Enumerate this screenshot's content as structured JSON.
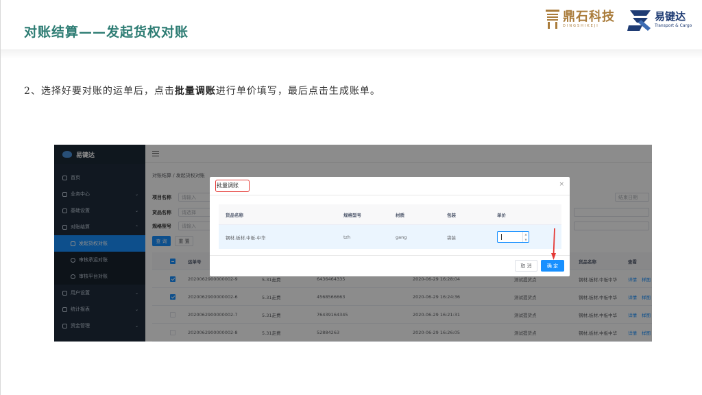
{
  "slide": {
    "title": "对账结算——发起货权对账",
    "instruction_prefix": "2、选择好要对账的运单后，点击",
    "instruction_bold": "批量调账",
    "instruction_suffix": "进行单价填写，最后点击生成账单。"
  },
  "logos": {
    "dingshi_cn": "鼎石科技",
    "dingshi_en": "DINGSHIKEJI",
    "yijianda_cn": "易键达",
    "yijianda_en": "Transport & Cargo"
  },
  "colors": {
    "title": "#2d7c73",
    "primary": "#1890ff",
    "sidebar": "#1f2d3d",
    "highlight_red": "#e53935"
  },
  "app": {
    "brand": "易键达",
    "sidebar": [
      {
        "label": "首页",
        "icon": "home-icon"
      },
      {
        "label": "业务中心",
        "icon": "briefcase-icon",
        "caret": "⌄"
      },
      {
        "label": "基础设置",
        "icon": "gear-icon",
        "caret": "⌄"
      },
      {
        "label": "对账结算",
        "icon": "ledger-icon",
        "caret": "⌃"
      },
      {
        "label": "发起货权对账",
        "icon": "doc-icon",
        "active": true
      },
      {
        "label": "审核承运对账",
        "icon": "check-circle-icon"
      },
      {
        "label": "审核平台对账",
        "icon": "check-circle-icon"
      },
      {
        "label": "用户设置",
        "icon": "user-icon",
        "caret": "⌄"
      },
      {
        "label": "统计报表",
        "icon": "chart-icon",
        "caret": "⌄"
      },
      {
        "label": "资金管理",
        "icon": "wallet-icon",
        "caret": "⌄"
      }
    ],
    "breadcrumb": "对账结算 / 发起货权对账",
    "filters": {
      "project_label": "项目名称",
      "project_placeholder": "请输入",
      "goods_label": "货品名称",
      "goods_placeholder": "请选择",
      "spec_label": "规格型号",
      "spec_placeholder": "请输入",
      "end_date_placeholder": "结束日期"
    },
    "buttons": {
      "query": "查 询",
      "reset": "重 置"
    },
    "table": {
      "headers": [
        "运单号",
        "货品名称",
        "查看"
      ],
      "rows": [
        {
          "checked": true,
          "waybill": "2020062900000002-9",
          "c2": "5.31走费",
          "c3": "6436464335",
          "time": "2020-06-29 16:28:04",
          "shipper": "测试提货点",
          "goods": "钢材,板材,中板中华",
          "view": "详情",
          "view2": "样图"
        },
        {
          "checked": true,
          "waybill": "2020062900000002-6",
          "c2": "5.31走费",
          "c3": "4568566663",
          "time": "2020-06-29 16:24:36",
          "shipper": "测试提货点",
          "goods": "钢材,板材,中板中华",
          "view": "详情",
          "view2": "样图"
        },
        {
          "checked": false,
          "waybill": "2020062900000002-7",
          "c2": "5.31走费",
          "c3": "76439164345",
          "time": "2020-06-29 16:21:31",
          "shipper": "测试提货点",
          "goods": "钢材,板材,中板中华",
          "view": "详情",
          "view2": "样图"
        },
        {
          "checked": false,
          "waybill": "2020062900000002-8",
          "c2": "5.31走费",
          "c3": "52884263",
          "time": "2020-06-29 16:26:05",
          "shipper": "测试提货点",
          "goods": "钢材,板材,中板中华",
          "view": "详情",
          "view2": "样图"
        }
      ]
    },
    "modal": {
      "title": "批量调账",
      "close": "×",
      "headers": {
        "goods": "货品名称",
        "spec": "规格型号",
        "material": "材质",
        "package": "包装",
        "price": "单价"
      },
      "row": {
        "goods": "钢材,板材,中板-中华",
        "spec": "tzh",
        "material": "gang",
        "package": "袋装"
      },
      "cancel": "取 消",
      "confirm": "确 定"
    }
  }
}
